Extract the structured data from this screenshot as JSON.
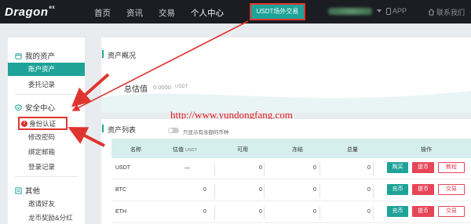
{
  "header": {
    "logo_text": "Dragon",
    "logo_sup": "ex",
    "nav": [
      "首页",
      "资讯",
      "交易",
      "个人中心"
    ],
    "otc_label": "USDT场外交易",
    "app_label": "APP",
    "contact_label": "联系我们"
  },
  "sidebar": {
    "assets_head": "我的资产",
    "account_assets": "账户资产",
    "orders": "委托记录",
    "security_head": "安全中心",
    "id_verify": "身份认证",
    "change_pwd": "修改密码",
    "bind_email": "绑定邮箱",
    "login_log": "登录记录",
    "other_head": "其他",
    "invite": "邀请好友",
    "dragon_reward": "龙币奖励&分红"
  },
  "overview": {
    "title": "资产概况",
    "est_label": "总估值",
    "est_value": "0.0000",
    "est_unit": "USDT",
    "watermark_url": "http://www.yundongfang.com"
  },
  "asset_list": {
    "title": "资产列表",
    "toggle_label": "只显示有余额的币种",
    "columns": {
      "name": "名称",
      "valuation": "估值",
      "valuation_unit": "USDT",
      "available": "可用",
      "frozen": "冻结",
      "total": "总量",
      "action": "操作"
    },
    "rows": [
      {
        "name": "USDT",
        "valuation": "—",
        "available": "0",
        "frozen": "0",
        "total": "0",
        "actions": [
          "购买",
          "提币",
          "教程"
        ]
      },
      {
        "name": "BTC",
        "valuation": "0",
        "available": "0",
        "frozen": "0",
        "total": "0",
        "actions": [
          "充币",
          "提币",
          "交易"
        ]
      },
      {
        "name": "ETH",
        "valuation": "0",
        "available": "0",
        "frozen": "0",
        "total": "0",
        "actions": [
          "充币",
          "提币",
          "交易"
        ]
      }
    ]
  },
  "colors": {
    "accent": "#1fa398",
    "danger": "#e64557",
    "highlight": "#e0342f"
  }
}
